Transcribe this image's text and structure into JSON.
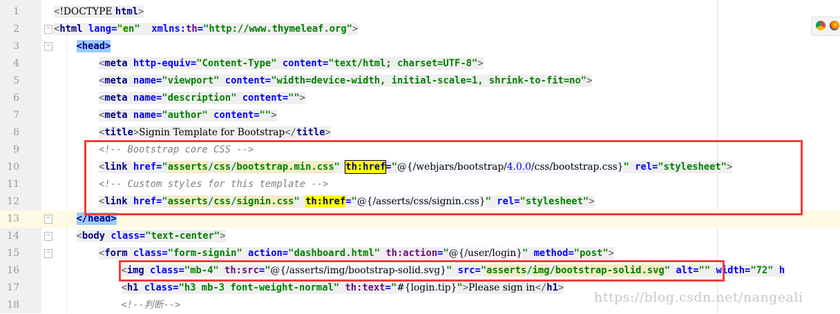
{
  "editor": {
    "current_line": 13,
    "lines": [
      {
        "n": "1",
        "indent": 0,
        "tokens": [
          [
            "punct",
            "<"
          ],
          [
            "text",
            "!DOCTYPE "
          ],
          [
            "tag",
            "html"
          ],
          [
            "punct",
            ">"
          ]
        ]
      },
      {
        "n": "2",
        "indent": 0,
        "fold": true,
        "tokens": [
          [
            "punct",
            "<"
          ],
          [
            "tag",
            "html "
          ],
          [
            "attr",
            "lang="
          ],
          [
            "val",
            "\"en\"  "
          ],
          [
            "attr",
            "xmlns:"
          ],
          [
            "th",
            "th"
          ],
          [
            "attr",
            "="
          ],
          [
            "val",
            "\"http://www.thymeleaf.org\""
          ],
          [
            "punct",
            ">"
          ]
        ]
      },
      {
        "n": "3",
        "indent": 1,
        "fold": true,
        "tokens": [
          [
            "sel",
            "<head>"
          ]
        ]
      },
      {
        "n": "4",
        "indent": 2,
        "tokens": [
          [
            "punct",
            "<"
          ],
          [
            "tag",
            "meta "
          ],
          [
            "attr",
            "http-equiv="
          ],
          [
            "val",
            "\"Content-Type\" "
          ],
          [
            "attr",
            "content="
          ],
          [
            "val",
            "\"text/html; charset=UTF-8\""
          ],
          [
            "punct",
            ">"
          ]
        ]
      },
      {
        "n": "5",
        "indent": 2,
        "tokens": [
          [
            "punct",
            "<"
          ],
          [
            "tag",
            "meta "
          ],
          [
            "attr",
            "name="
          ],
          [
            "val",
            "\"viewport\" "
          ],
          [
            "attr",
            "content="
          ],
          [
            "val",
            "\"width=device-width, initial-scale=1, shrink-to-fit=no\""
          ],
          [
            "punct",
            ">"
          ]
        ]
      },
      {
        "n": "6",
        "indent": 2,
        "tokens": [
          [
            "punct",
            "<"
          ],
          [
            "tag",
            "meta "
          ],
          [
            "attr",
            "name="
          ],
          [
            "val",
            "\"description\" "
          ],
          [
            "attr",
            "content="
          ],
          [
            "val",
            "\"\""
          ],
          [
            "punct",
            ">"
          ]
        ]
      },
      {
        "n": "7",
        "indent": 2,
        "tokens": [
          [
            "punct",
            "<"
          ],
          [
            "tag",
            "meta "
          ],
          [
            "attr",
            "name="
          ],
          [
            "val",
            "\"author\" "
          ],
          [
            "attr",
            "content="
          ],
          [
            "val",
            "\"\""
          ],
          [
            "punct",
            ">"
          ]
        ]
      },
      {
        "n": "8",
        "indent": 2,
        "tokens": [
          [
            "punct",
            "<"
          ],
          [
            "tag",
            "title"
          ],
          [
            "punct",
            ">"
          ],
          [
            "text",
            "Signin Template for Bootstrap"
          ],
          [
            "punct",
            "</"
          ],
          [
            "tag",
            "title"
          ],
          [
            "punct",
            ">"
          ]
        ]
      },
      {
        "n": "9",
        "indent": 2,
        "tokens": [
          [
            "comment",
            "<!-- Bootstrap core CSS -->"
          ]
        ]
      },
      {
        "n": "10",
        "indent": 2,
        "tokens": [
          [
            "punct",
            "<"
          ],
          [
            "tag",
            "link "
          ],
          [
            "attr",
            "href="
          ],
          [
            "val",
            "\""
          ],
          [
            "path",
            "asserts"
          ],
          [
            "val",
            "/"
          ],
          [
            "path",
            "css"
          ],
          [
            "val",
            "/"
          ],
          [
            "path",
            "bootstrap.min.css"
          ],
          [
            "val",
            "\" "
          ],
          [
            "hl",
            "th:href"
          ],
          [
            "attr",
            "="
          ],
          [
            "val",
            "\""
          ],
          [
            "expr",
            "@{/webjars/bootstrap/"
          ],
          [
            "num",
            "4.0.0"
          ],
          [
            "expr",
            "/css/bootstrap.css}"
          ],
          [
            "val",
            "\" "
          ],
          [
            "attr",
            "rel="
          ],
          [
            "val",
            "\"stylesheet\""
          ],
          [
            "punct",
            ">"
          ]
        ]
      },
      {
        "n": "11",
        "indent": 2,
        "tokens": [
          [
            "comment",
            "<!-- Custom styles for this template -->"
          ]
        ]
      },
      {
        "n": "12",
        "indent": 2,
        "tokens": [
          [
            "punct",
            "<"
          ],
          [
            "tag",
            "link "
          ],
          [
            "attr",
            "href="
          ],
          [
            "val",
            "\""
          ],
          [
            "path",
            "asserts"
          ],
          [
            "val",
            "/"
          ],
          [
            "path",
            "css"
          ],
          [
            "val",
            "/"
          ],
          [
            "path",
            "signin.css"
          ],
          [
            "val",
            "\" "
          ],
          [
            "hl2",
            "th:href"
          ],
          [
            "attr",
            "="
          ],
          [
            "val",
            "\""
          ],
          [
            "expr",
            "@{/asserts/css/signin.css}"
          ],
          [
            "val",
            "\" "
          ],
          [
            "attr",
            "rel="
          ],
          [
            "val",
            "\"stylesheet\""
          ],
          [
            "punct",
            ">"
          ]
        ]
      },
      {
        "n": "13",
        "indent": 1,
        "fold": true,
        "tokens": [
          [
            "sel",
            "</head>"
          ]
        ]
      },
      {
        "n": "14",
        "indent": 1,
        "fold": true,
        "tokens": [
          [
            "punct",
            "<"
          ],
          [
            "tag",
            "body "
          ],
          [
            "attr",
            "class="
          ],
          [
            "val",
            "\"text-center\""
          ],
          [
            "punct",
            ">"
          ]
        ]
      },
      {
        "n": "15",
        "indent": 2,
        "fold": true,
        "tokens": [
          [
            "punct",
            "<"
          ],
          [
            "tag",
            "form "
          ],
          [
            "attr",
            "class="
          ],
          [
            "val",
            "\"form-signin\" "
          ],
          [
            "attr",
            "action="
          ],
          [
            "val",
            "\"dashboard.html\" "
          ],
          [
            "th",
            "th:action"
          ],
          [
            "attr",
            "="
          ],
          [
            "val",
            "\""
          ],
          [
            "expr",
            "@{/user/login}"
          ],
          [
            "val",
            "\" "
          ],
          [
            "attr",
            "method="
          ],
          [
            "val",
            "\"post\""
          ],
          [
            "punct",
            ">"
          ]
        ]
      },
      {
        "n": "16",
        "indent": 3,
        "tokens": [
          [
            "punct",
            "<"
          ],
          [
            "tag",
            "img "
          ],
          [
            "attr",
            "class="
          ],
          [
            "val",
            "\"mb-4\" "
          ],
          [
            "th",
            "th:src"
          ],
          [
            "attr",
            "="
          ],
          [
            "val",
            "\""
          ],
          [
            "expr",
            "@{/asserts/img/bootstrap-solid.svg}"
          ],
          [
            "val",
            "\" "
          ],
          [
            "attr",
            "src="
          ],
          [
            "val",
            "\""
          ],
          [
            "path",
            "asserts"
          ],
          [
            "val",
            "/"
          ],
          [
            "path",
            "img"
          ],
          [
            "val",
            "/"
          ],
          [
            "path",
            "bootstrap-solid.svg"
          ],
          [
            "val",
            "\" "
          ],
          [
            "attr",
            "alt="
          ],
          [
            "val",
            "\"\" "
          ],
          [
            "attr",
            "width="
          ],
          [
            "val",
            "\"72\" "
          ],
          [
            "attr",
            "h"
          ]
        ]
      },
      {
        "n": "17",
        "indent": 3,
        "tokens": [
          [
            "punct",
            "<"
          ],
          [
            "tag",
            "h1 "
          ],
          [
            "attr",
            "class="
          ],
          [
            "val",
            "\"h3 mb-3 font-weight-normal\" "
          ],
          [
            "th",
            "th:text"
          ],
          [
            "attr",
            "="
          ],
          [
            "val",
            "\""
          ],
          [
            "expr",
            "#{login.tip}"
          ],
          [
            "val",
            "\""
          ],
          [
            "punct",
            ">"
          ],
          [
            "text",
            "Please sign in"
          ],
          [
            "punct",
            "</"
          ],
          [
            "tag",
            "h1"
          ],
          [
            "punct",
            ">"
          ]
        ]
      },
      {
        "n": "18",
        "indent": 3,
        "tokens": [
          [
            "comment",
            "<!--判断-->"
          ]
        ]
      }
    ]
  },
  "watermark": "https://blog.csdn.net/nangeali",
  "browser_icons": [
    "chrome-icon",
    "firefox-icon"
  ],
  "colors": {
    "annotation_box": "#f03c3c",
    "current_line": "#fffae3",
    "highlight": "#ffff00"
  }
}
